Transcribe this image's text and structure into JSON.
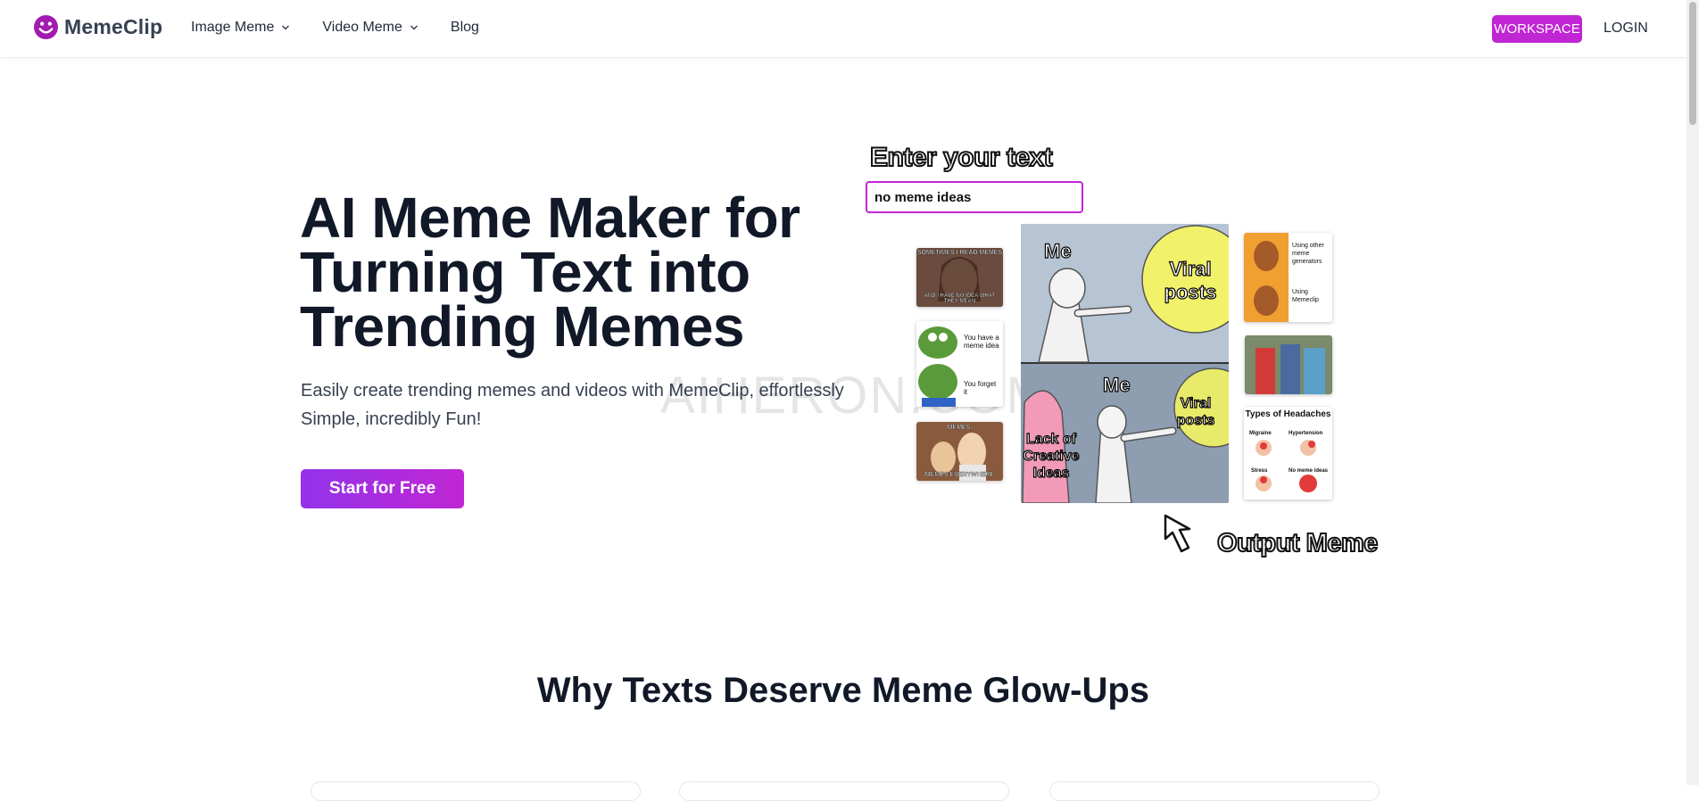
{
  "brand": {
    "name": "MemeClip",
    "accent": "#c026d3"
  },
  "nav": {
    "items": [
      {
        "label": "Image Meme",
        "has_dropdown": true
      },
      {
        "label": "Video Meme",
        "has_dropdown": true
      },
      {
        "label": "Blog",
        "has_dropdown": false
      }
    ],
    "workspace_label": "WORKSPACE",
    "login_label": "LOGIN"
  },
  "hero": {
    "title": "AI Meme Maker for Turning Text into Trending Memes",
    "subtitle": "Easily create trending memes and videos with MemeClip, effortlessly Simple, incredibly Fun!",
    "cta_label": "Start for Free"
  },
  "watermark": "AIHERON.COM",
  "demo": {
    "enter_label": "Enter your text",
    "input_value": "no meme ideas",
    "output_label": "Output Meme",
    "main_meme": {
      "top_me": "Me",
      "top_viral": "Viral posts",
      "bottom_lack": "Lack of Creative Ideas",
      "bottom_me": "Me",
      "bottom_viral": "Viral posts"
    },
    "left_thumbs": {
      "crying_top": "SOMETIMES I READ MEMES",
      "crying_bottom": "AND I HAVE NO IDEA WHAT THEY MEAN",
      "pepe_top": "You have a meme idea",
      "pepe_bottom": "You forget it",
      "toy_top": "MEMES,",
      "toy_bottom": "MEMES EVERYWHERE"
    },
    "right_thumbs": {
      "drake_top": "Using other meme generators",
      "drake_bottom": "Using Memeclip",
      "headache_title": "Types of Headaches",
      "headache_labels": [
        "Migraine",
        "Hypertension",
        "Stress",
        "No meme ideas"
      ]
    }
  },
  "section": {
    "title": "Why Texts Deserve Meme Glow-Ups"
  }
}
